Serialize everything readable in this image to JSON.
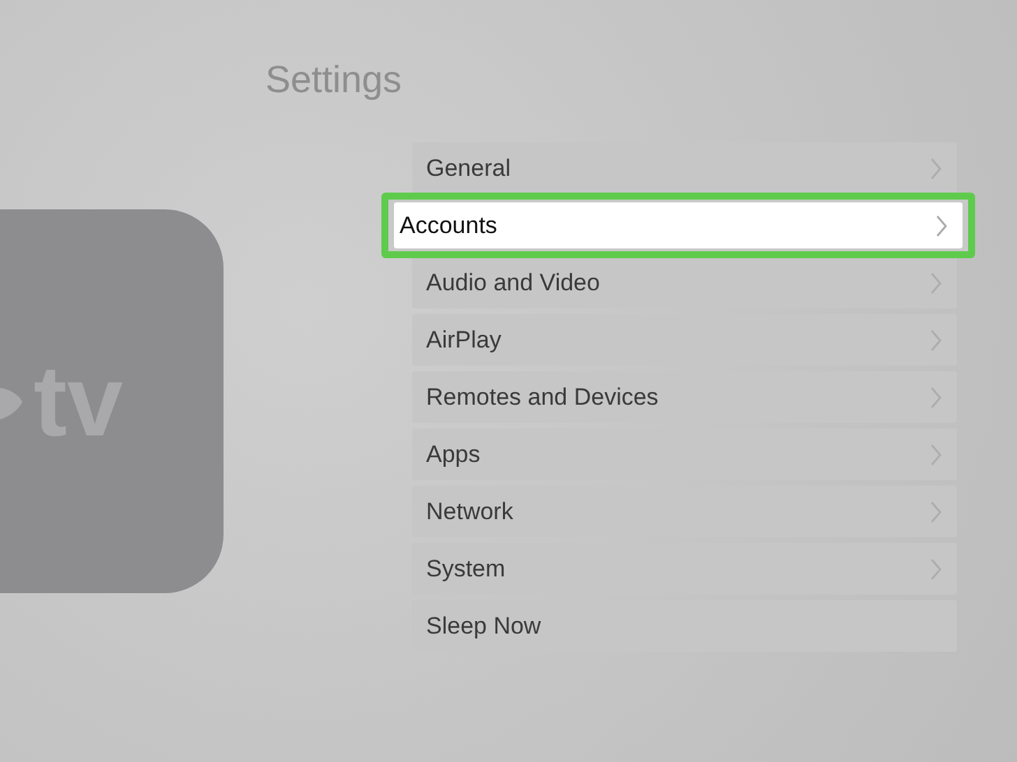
{
  "title": "Settings",
  "device_tile": {
    "label": "tv"
  },
  "items": [
    {
      "label": "General",
      "selected": false,
      "chevron": true
    },
    {
      "label": "Accounts",
      "selected": true,
      "chevron": true
    },
    {
      "label": "Audio and Video",
      "selected": false,
      "chevron": true
    },
    {
      "label": "AirPlay",
      "selected": false,
      "chevron": true
    },
    {
      "label": "Remotes and Devices",
      "selected": false,
      "chevron": true
    },
    {
      "label": "Apps",
      "selected": false,
      "chevron": true
    },
    {
      "label": "Network",
      "selected": false,
      "chevron": true
    },
    {
      "label": "System",
      "selected": false,
      "chevron": true
    },
    {
      "label": "Sleep Now",
      "selected": false,
      "chevron": false
    }
  ]
}
